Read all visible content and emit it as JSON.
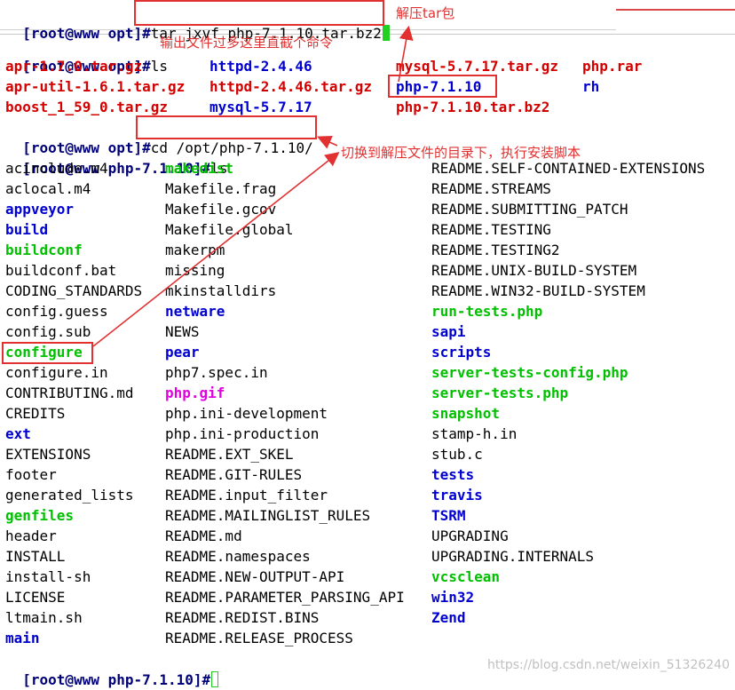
{
  "commands": {
    "extract": {
      "prompt": "[root@www opt]#",
      "command": "tar jxvf php-7.1.10.tar.bz2"
    },
    "ls_opt": {
      "prompt": "[root@www opt]#",
      "command": "ls"
    },
    "cd": {
      "prompt": "[root@www opt]#",
      "command": "cd /opt/php-7.1.10/"
    },
    "ls_php": {
      "prompt": "[root@www php-7.1.10]#",
      "command": "ls"
    },
    "final": {
      "prompt": "[root@www php-7.1.10]#"
    }
  },
  "opt_listing": [
    [
      "apr-1.7.0.tar.gz",
      "httpd-2.4.46",
      "mysql-5.7.17.tar.gz",
      "php.rar"
    ],
    [
      "apr-util-1.6.1.tar.gz",
      "httpd-2.4.46.tar.gz",
      "php-7.1.10",
      "rh"
    ],
    [
      "boost_1_59_0.tar.gz",
      "mysql-5.7.17",
      "php-7.1.10.tar.bz2",
      ""
    ]
  ],
  "php_listing": {
    "col1": [
      "acinclude.m4",
      "aclocal.m4",
      "appveyor",
      "build",
      "buildconf",
      "buildconf.bat",
      "CODING_STANDARDS",
      "config.guess",
      "config.sub",
      "configure",
      "configure.in",
      "CONTRIBUTING.md",
      "CREDITS",
      "ext",
      "EXTENSIONS",
      "footer",
      "generated_lists",
      "genfiles",
      "header",
      "INSTALL",
      "install-sh",
      "LICENSE",
      "ltmain.sh",
      "main"
    ],
    "col2": [
      "makedist",
      "Makefile.frag",
      "Makefile.gcov",
      "Makefile.global",
      "makerpm",
      "missing",
      "mkinstalldirs",
      "netware",
      "NEWS",
      "pear",
      "php7.spec.in",
      "php.gif",
      "php.ini-development",
      "php.ini-production",
      "README.EXT_SKEL",
      "README.GIT-RULES",
      "README.input_filter",
      "README.MAILINGLIST_RULES",
      "README.md",
      "README.namespaces",
      "README.NEW-OUTPUT-API",
      "README.PARAMETER_PARSING_API",
      "README.REDIST.BINS",
      "README.RELEASE_PROCESS"
    ],
    "col3": [
      "README.SELF-CONTAINED-EXTENSIONS",
      "README.STREAMS",
      "README.SUBMITTING_PATCH",
      "README.TESTING",
      "README.TESTING2",
      "README.UNIX-BUILD-SYSTEM",
      "README.WIN32-BUILD-SYSTEM",
      "run-tests.php",
      "sapi",
      "scripts",
      "server-tests-config.php",
      "server-tests.php",
      "snapshot",
      "stamp-h.in",
      "stub.c",
      "tests",
      "travis",
      "TSRM",
      "UPGRADING",
      "UPGRADING.INTERNALS",
      "vcsclean",
      "win32",
      "Zend",
      ""
    ]
  },
  "annotations": {
    "extract_note": "解压tar包",
    "ls_note": "输出文件过多这里直截个命令",
    "cd_note": "切换到解压文件的目录下，执行安装脚本"
  },
  "watermark": "https://blog.csdn.net/weixin_51326240",
  "colors": {
    "prompt": "#00007a",
    "archive": "#d40000",
    "directory": "#0000d0",
    "executable": "#00c000",
    "image": "#e000e0",
    "annotation": "#e23131",
    "cursor": "#22d022"
  }
}
